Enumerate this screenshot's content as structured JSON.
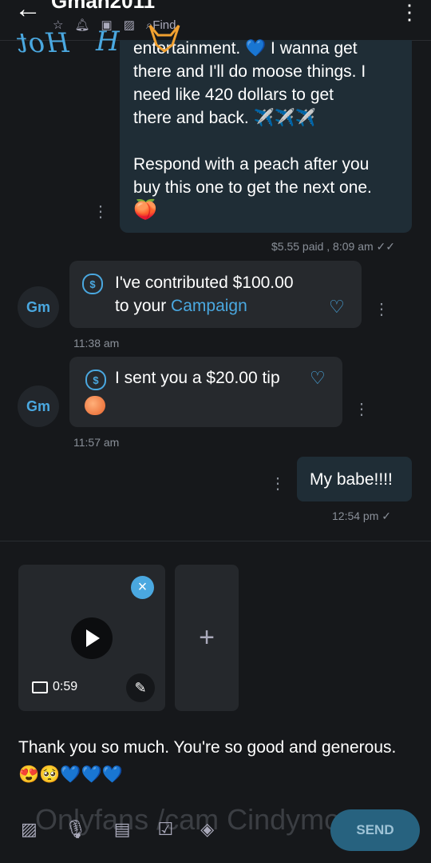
{
  "header": {
    "back_icon": "←",
    "title": "Gman2011",
    "find_label": "Find",
    "menu_icon": "⋮"
  },
  "watermarks": {
    "top": "Hot Leak",
    "bottom": "Onlyfans /cam Cindymoon7"
  },
  "messages": {
    "m1": {
      "text": "entertainment. 💙 I wanna get\nthere and I'll do moose things. I\nneed like 420 dollars to get\nthere and back. ✈️✈️✈️\n\nRespond with a peach after you\nbuy this one to get the next one.",
      "emoji": "🍑",
      "meta": "$5.55 paid , 8:09 am ✓✓"
    },
    "m2": {
      "avatar": "Gm",
      "line1": "I've contributed $100.00",
      "line2_prefix": "to your ",
      "line2_link": "Campaign",
      "time": "11:38 am"
    },
    "m3": {
      "avatar": "Gm",
      "text": "I sent you a $20.00 tip",
      "time": "11:57 am"
    },
    "m4": {
      "text": "My babe!!!!",
      "time": "12:54 pm ✓"
    }
  },
  "attachment": {
    "duration": "0:59",
    "close_icon": "×",
    "add_icon": "+",
    "edit_icon": "✎"
  },
  "composer": {
    "text": "Thank you so much. You're so good and generous. 😍🥺💙💙💙",
    "send_label": "SEND"
  },
  "colors": {
    "background": "#16181b",
    "accent": "#4aa8e0",
    "outgoing_bubble": "#1f2d36",
    "incoming_bubble": "#26292d"
  }
}
